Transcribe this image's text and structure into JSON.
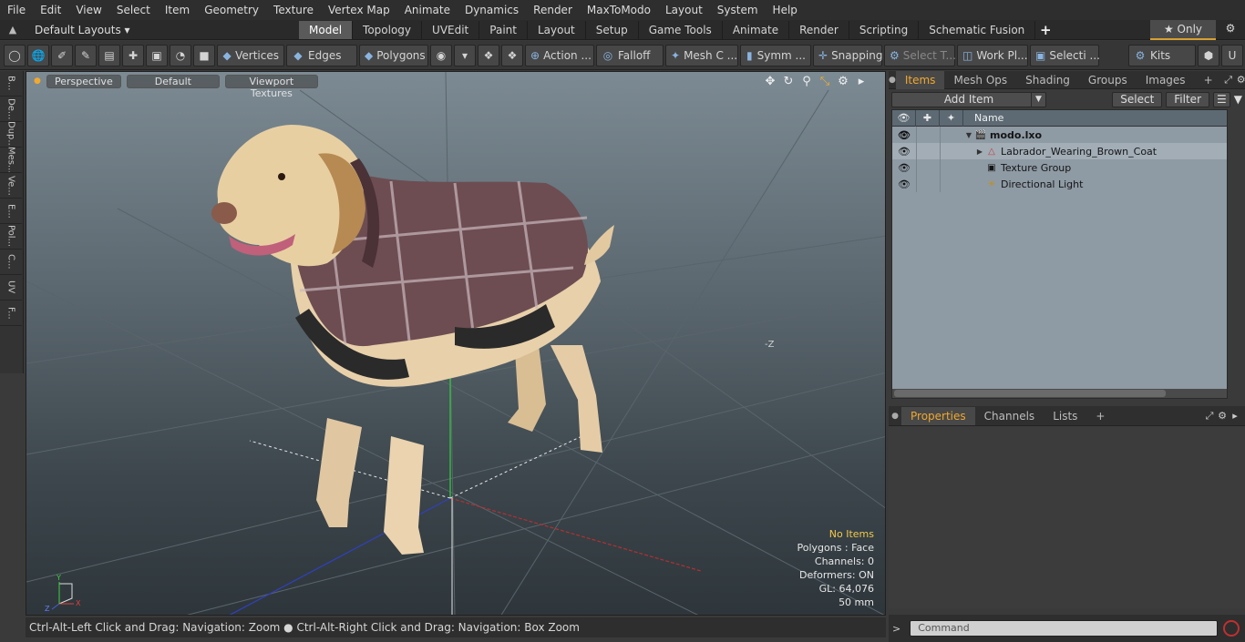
{
  "menu": [
    "File",
    "Edit",
    "View",
    "Select",
    "Item",
    "Geometry",
    "Texture",
    "Vertex Map",
    "Animate",
    "Dynamics",
    "Render",
    "MaxToModo",
    "Layout",
    "System",
    "Help"
  ],
  "layout": {
    "selector": "Default Layouts ▾",
    "tabs": [
      "Model",
      "Topology",
      "UVEdit",
      "Paint",
      "Layout",
      "Setup",
      "Game Tools",
      "Animate",
      "Render",
      "Scripting",
      "Schematic Fusion"
    ],
    "active_tab": "Model",
    "plus": "+",
    "only": "★ Only"
  },
  "toolbar": {
    "vertices": "Vertices",
    "edges": "Edges",
    "polygons": "Polygons",
    "action": "Action ...",
    "falloff": "Falloff",
    "mesh": "Mesh C ...",
    "symm": "Symm ...",
    "snapping": "Snapping",
    "select_t": "Select T...",
    "workpl": "Work Pl...",
    "selecti": "Selecti ...",
    "kits": "Kits"
  },
  "left_tabs": [
    "B...",
    "De...",
    "Dup...",
    "Mes...",
    "Ve...",
    "E...",
    "Pol...",
    "C...",
    "UV",
    "F..."
  ],
  "viewport": {
    "perspective": "Perspective",
    "default": "Default",
    "textures": "Viewport Textures",
    "info": {
      "items": "No Items",
      "polygons": "Polygons : Face",
      "channels": "Channels: 0",
      "deformers": "Deformers: ON",
      "gl": "GL: 64,076",
      "mm": "50 mm"
    },
    "axis_z": "-Z"
  },
  "status": "Ctrl-Alt-Left Click and Drag: Navigation: Zoom ● Ctrl-Alt-Right Click and Drag: Navigation: Box Zoom",
  "items_panel": {
    "tabs": [
      "Items",
      "Mesh Ops",
      "Shading",
      "Groups",
      "Images"
    ],
    "active": "Items",
    "add_item": "Add Item",
    "select": "Select",
    "filter": "Filter",
    "name_header": "Name",
    "rows": [
      {
        "label": "modo.lxo",
        "bold": true
      },
      {
        "label": "Labrador_Wearing_Brown_Coat"
      },
      {
        "label": "Texture Group"
      },
      {
        "label": "Directional Light"
      }
    ]
  },
  "props_panel": {
    "tabs": [
      "Properties",
      "Channels",
      "Lists"
    ],
    "active": "Properties"
  },
  "command": {
    "placeholder": "Command"
  }
}
